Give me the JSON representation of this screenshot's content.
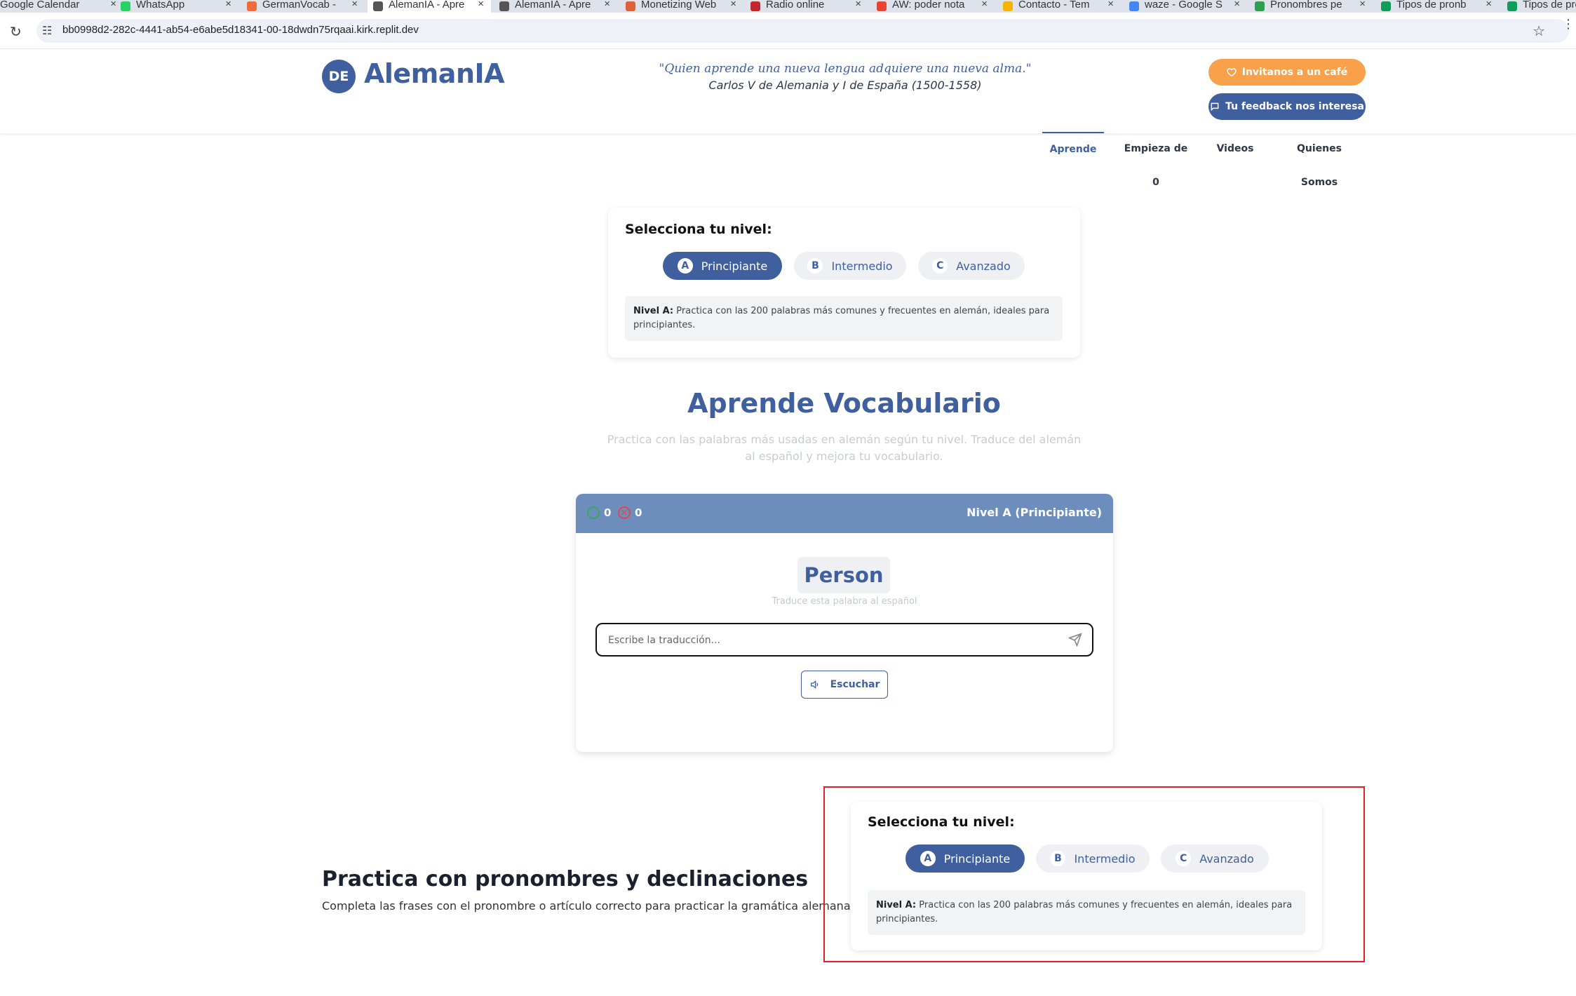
{
  "browser": {
    "tabs": [
      {
        "title": "Google Calendar",
        "color": "#4285f4"
      },
      {
        "title": "WhatsApp",
        "color": "#25d366"
      },
      {
        "title": "GermanVocab -",
        "color": "#f26b3a"
      },
      {
        "title": "AlemanIA - Apre",
        "color": "#555555"
      },
      {
        "title": "AlemanIA - Apre",
        "color": "#555555"
      },
      {
        "title": "Monetizing Web",
        "color": "#e0603a"
      },
      {
        "title": "Radio online",
        "color": "#c0282d"
      },
      {
        "title": "AW: poder nota",
        "color": "#ea4335"
      },
      {
        "title": "Contacto - Tem",
        "color": "#f4b400"
      },
      {
        "title": "waze - Google S",
        "color": "#4285f4"
      },
      {
        "title": "Pronombres pe",
        "color": "#2e9e4f"
      },
      {
        "title": "Tipos de pronb",
        "color": "#0f9d58"
      },
      {
        "title": "Tipos de pro",
        "color": "#0f9d58"
      }
    ],
    "url": "bb0998d2-282c-4441-ab54-e6abe5d18341-00-18dwdn75rqaai.kirk.replit.dev"
  },
  "header": {
    "logo_badge": "DE",
    "logo_text": "AlemanIA",
    "quote": "\"Quien aprende una nueva lengua adquiere una nueva alma.\"",
    "quote_author": "Carlos V de Alemania y I de España (1500-1558)",
    "cafe_button": "Invitanos a un café",
    "feedback_button": "Tu feedback nos interesa"
  },
  "nav": {
    "items": [
      "Aprende",
      "Empieza de 0",
      "Videos",
      "Quienes Somos"
    ],
    "active": "Aprende"
  },
  "level_selector": {
    "title": "Selecciona tu nivel:",
    "options": [
      {
        "letter": "A",
        "label": "Principiante"
      },
      {
        "letter": "B",
        "label": "Intermedio"
      },
      {
        "letter": "C",
        "label": "Avanzado"
      }
    ],
    "selected": "A",
    "desc_label": "Nivel A:",
    "desc_text": "Practica con las 200 palabras más comunes y frecuentes en alemán, ideales para principiantes."
  },
  "vocab": {
    "title": "Aprende Vocabulario",
    "subtitle": "Practica con las palabras más usadas en alemán según tu nivel. Traduce del alemán al español y mejora tu vocabulario."
  },
  "quiz": {
    "correct": "0",
    "wrong": "0",
    "level": "Nivel A (Principiante)",
    "word": "Person",
    "hint": "Traduce esta palabra al español",
    "input_placeholder": "Escribe la traducción...",
    "input_value": "",
    "listen_button": "Escuchar"
  },
  "pronouns": {
    "title": "Practica con pronombres y declinaciones",
    "subtitle": "Completa las frases con el pronombre o artículo correcto para practicar la gramática alemana."
  },
  "colors": {
    "brand": "#3f5f9e",
    "accent": "#f8a14a",
    "quiz_header": "#6d8ebd",
    "highlight": "#e02020"
  }
}
